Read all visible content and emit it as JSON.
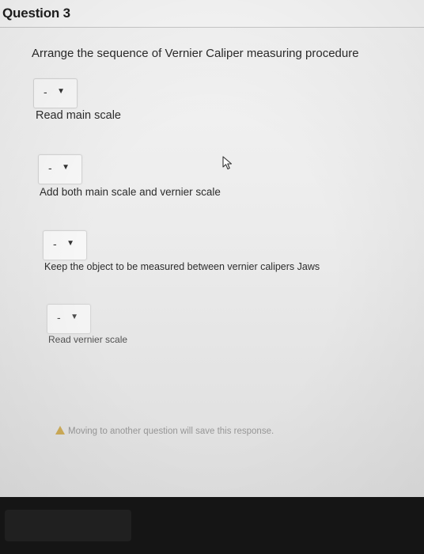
{
  "question": {
    "title": "Question 3",
    "prompt": "Arrange the sequence of Vernier Caliper  measuring procedure"
  },
  "items": [
    {
      "dropdown_value": "-",
      "label": "Read  main scale"
    },
    {
      "dropdown_value": "-",
      "label": "Add both main scale and vernier scale"
    },
    {
      "dropdown_value": "-",
      "label": "Keep the object to be measured between vernier calipers Jaws"
    },
    {
      "dropdown_value": "-",
      "label": "Read vernier scale"
    }
  ],
  "notice": {
    "text": "Moving to another question will save this response.",
    "icon": "warning-icon"
  },
  "icons": {
    "dropdown_arrow": "▼"
  }
}
